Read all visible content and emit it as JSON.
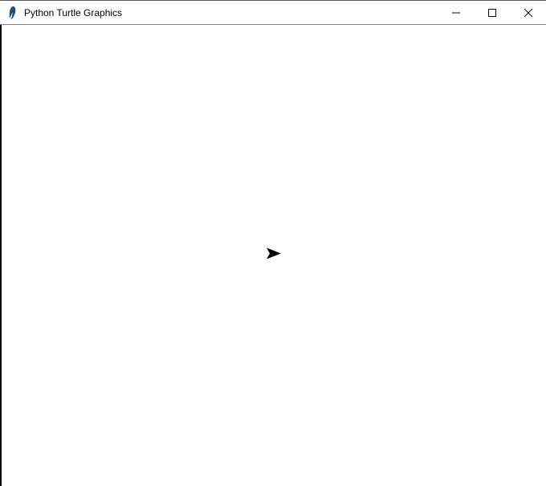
{
  "window": {
    "title": "Python Turtle Graphics",
    "icon_name": "feather-icon"
  },
  "controls": {
    "minimize_label": "Minimize",
    "maximize_label": "Maximize",
    "close_label": "Close"
  },
  "canvas": {
    "turtle": {
      "name": "turtle-cursor",
      "heading_deg": 0
    }
  }
}
